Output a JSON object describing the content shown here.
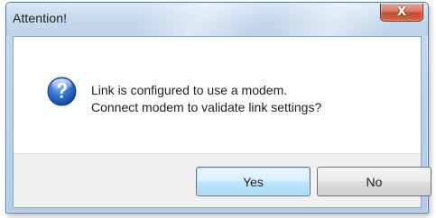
{
  "window": {
    "title": "Attention!",
    "close_label": "X"
  },
  "dialog": {
    "icon": "question-icon",
    "message_line1": "Link is configured to use a modem.",
    "message_line2": "Connect modem to validate link settings?"
  },
  "buttons": {
    "yes_label": "Yes",
    "no_label": "No"
  },
  "colors": {
    "frame": "#bcd3ea",
    "close_button": "#c44a2d",
    "icon_blue": "#1f5fbf",
    "button_bar": "#f0f0f0"
  }
}
